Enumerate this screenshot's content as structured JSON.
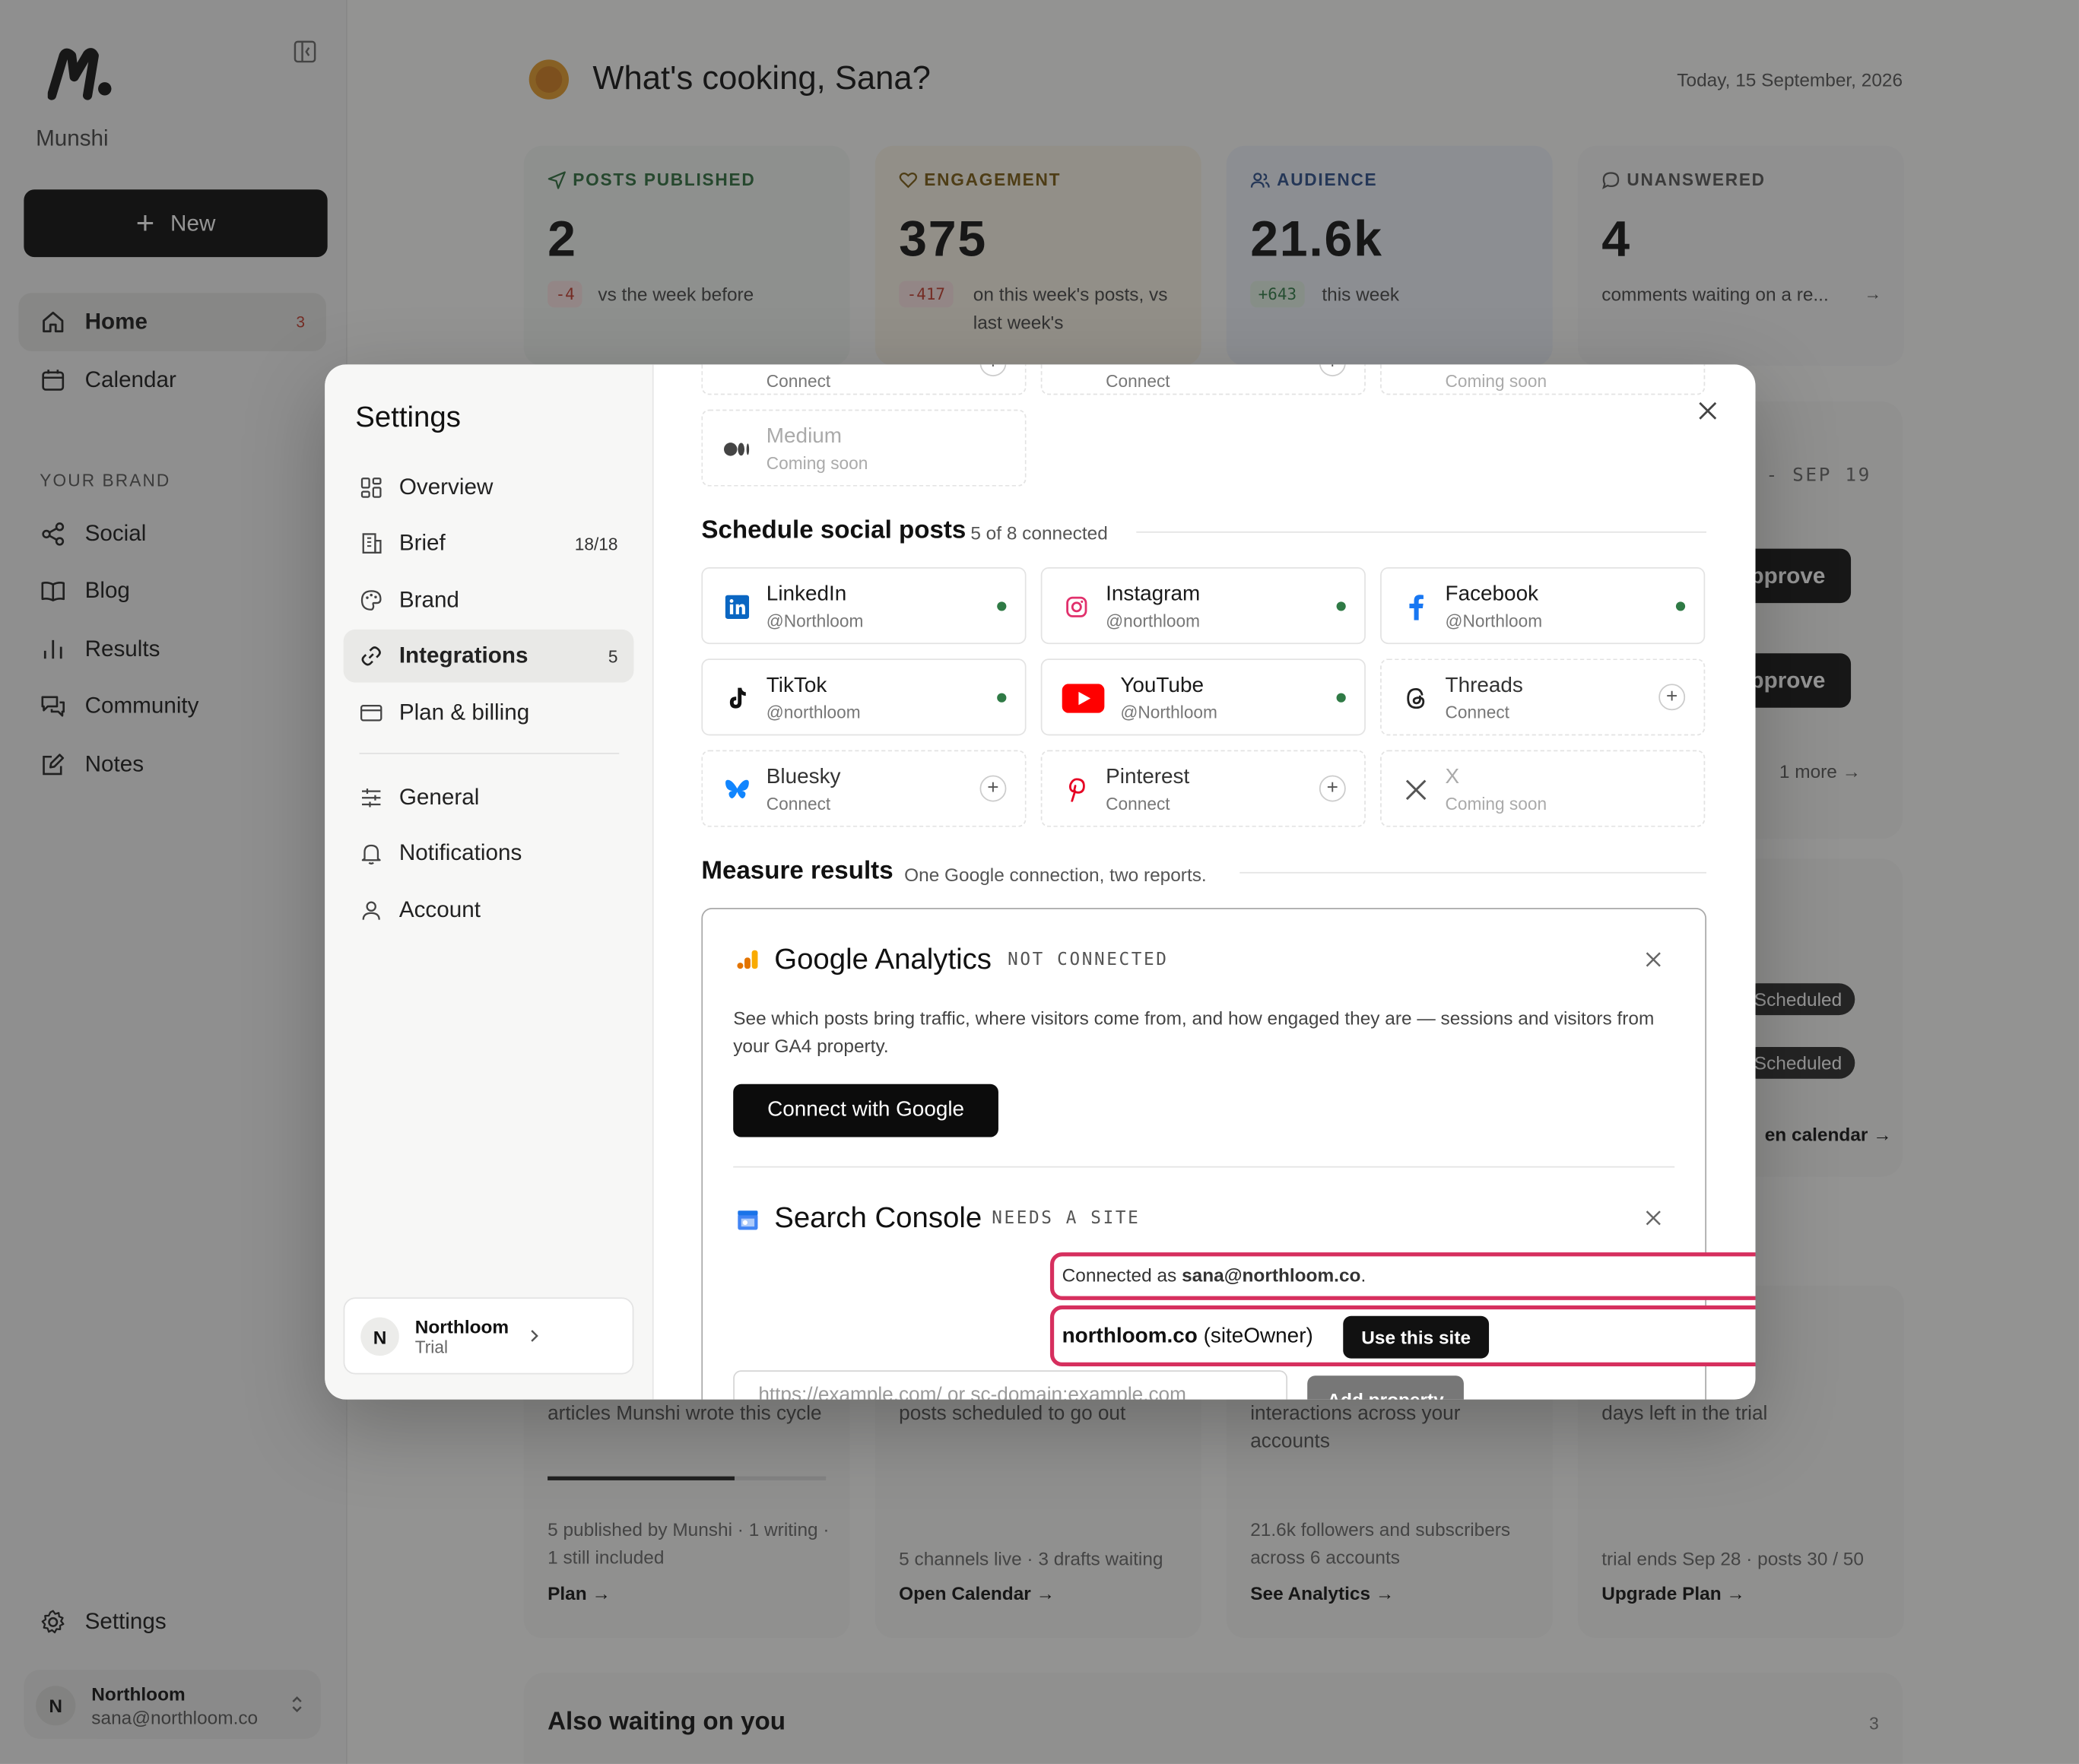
{
  "app": {
    "name": "Munshi"
  },
  "sidebar": {
    "new_label": "New",
    "items": [
      {
        "label": "Home",
        "badge": "3"
      },
      {
        "label": "Calendar"
      }
    ],
    "brand_heading": "YOUR BRAND",
    "brand_items": [
      {
        "label": "Social"
      },
      {
        "label": "Blog"
      },
      {
        "label": "Results"
      },
      {
        "label": "Community"
      },
      {
        "label": "Notes"
      }
    ],
    "settings_label": "Settings",
    "account": {
      "initial": "N",
      "name": "Northloom",
      "email": "sana@northloom.co"
    }
  },
  "header": {
    "greeting": "What's cooking, Sana?",
    "date": "Today, 15 September, 2026"
  },
  "stats": [
    {
      "label": "POSTS PUBLISHED",
      "value": "2",
      "delta": "-4",
      "sub": "vs the week before",
      "color": "#2f6e3e"
    },
    {
      "label": "ENGAGEMENT",
      "value": "375",
      "delta": "-417",
      "sub": "on this week's posts, vs last week's",
      "color": "#7a5a10"
    },
    {
      "label": "AUDIENCE",
      "value": "21.6k",
      "delta": "+643",
      "sub": "this week",
      "color": "#2c4e8a"
    },
    {
      "label": "UNANSWERED",
      "value": "4",
      "sub": "comments waiting on a re..."
    }
  ],
  "background_peek": {
    "range": "- SEP 19",
    "approve_1": "pprove",
    "approve_2": "pprove",
    "more": "1 more",
    "scheduled_1": "Scheduled",
    "scheduled_2": "Scheduled",
    "calendar_link": "en calendar →"
  },
  "bottom_cards": [
    {
      "text": "articles Munshi wrote this cycle",
      "progress": 0.67,
      "sub": "5 published by Munshi · 1 writing · 1 still included",
      "link": "Plan →"
    },
    {
      "text": "posts scheduled to go out",
      "sub": "5 channels live · 3 drafts waiting",
      "link": "Open Calendar →"
    },
    {
      "text": "interactions across your accounts",
      "sub": "21.6k followers and subscribers across 6 accounts",
      "link": "See Analytics →"
    },
    {
      "text": "days left in the trial",
      "sub": "trial ends Sep 28 · posts 30 / 50",
      "link": "Upgrade Plan →"
    }
  ],
  "also_waiting": {
    "title": "Also waiting on you",
    "count": "3"
  },
  "settings": {
    "title": "Settings",
    "nav": [
      {
        "label": "Overview",
        "icon": "grid-icon"
      },
      {
        "label": "Brief",
        "badge": "18/18",
        "icon": "building-icon"
      },
      {
        "label": "Brand",
        "icon": "palette-icon"
      },
      {
        "label": "Integrations",
        "badge": "5",
        "icon": "link-icon"
      },
      {
        "label": "Plan & billing",
        "icon": "card-icon"
      },
      {
        "label": "General",
        "icon": "sliders-icon"
      },
      {
        "label": "Notifications",
        "icon": "bell-icon"
      },
      {
        "label": "Account",
        "icon": "user-icon"
      }
    ],
    "workspace": {
      "initial": "N",
      "name": "Northloom",
      "plan": "Trial"
    },
    "top_tiles": [
      {
        "status": "Connect"
      },
      {
        "status": "Connect"
      },
      {
        "status": "Coming soon"
      }
    ],
    "medium": {
      "name": "Medium",
      "status": "Coming soon"
    },
    "schedule": {
      "title": "Schedule social posts",
      "sub": "5 of 8 connected",
      "tiles": [
        {
          "name": "LinkedIn",
          "handle": "@Northloom",
          "icon": "linkedin-icon",
          "color": "#0a66c2"
        },
        {
          "name": "Instagram",
          "handle": "@northloom",
          "icon": "instagram-icon",
          "color": "#e1306c"
        },
        {
          "name": "Facebook",
          "handle": "@Northloom",
          "icon": "facebook-icon",
          "color": "#1877f2"
        },
        {
          "name": "TikTok",
          "handle": "@northloom",
          "icon": "tiktok-icon"
        },
        {
          "name": "YouTube",
          "handle": "@Northloom",
          "icon": "youtube-icon",
          "color": "#ff0000"
        },
        {
          "name": "Threads",
          "handle": "Connect",
          "icon": "threads-icon"
        },
        {
          "name": "Bluesky",
          "handle": "Connect",
          "icon": "bluesky-icon",
          "color": "#1185fe"
        },
        {
          "name": "Pinterest",
          "handle": "Connect",
          "icon": "pinterest-icon",
          "color": "#e60023"
        },
        {
          "name": "X",
          "handle": "Coming soon",
          "icon": "x-icon"
        }
      ]
    },
    "measure": {
      "title": "Measure results",
      "sub": "One Google connection, two reports.",
      "ga": {
        "title": "Google Analytics",
        "status": "NOT CONNECTED",
        "desc": "See which posts bring traffic, where visitors come from, and how engaged they are — sessions and visitors from your GA4 property.",
        "button": "Connect with Google"
      },
      "sc": {
        "title": "Search Console",
        "status": "NEEDS A SITE",
        "connected_prefix": "Connected as ",
        "connected_email": "sana@northloom.co",
        "connected_suffix": ".",
        "site": "northloom.co",
        "site_role": "(siteOwner)",
        "use_button": "Use this site",
        "input_placeholder": "https://example.com/ or sc-domain:example.com",
        "add_button": "Add property"
      }
    }
  }
}
